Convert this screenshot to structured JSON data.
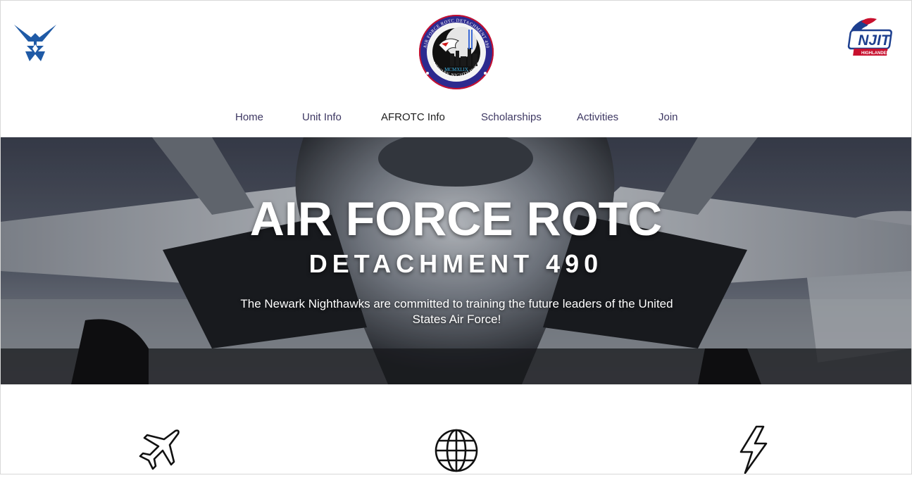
{
  "header": {
    "left_logo": "air-force-wings-logo",
    "center_logo": {
      "ring_top_text": "AIR FORCE ROTC DETACHMENT 490",
      "ring_bottom_text": "NEWARK NIGHTHAWKS",
      "center_text": "MCMXLIX"
    },
    "right_logo": {
      "name": "NJIT",
      "sub": "HIGHLANDERS"
    }
  },
  "nav": {
    "items": [
      {
        "label": "Home"
      },
      {
        "label": "Unit Info"
      },
      {
        "label": "AFROTC Info"
      },
      {
        "label": "Scholarships"
      },
      {
        "label": "Activities"
      },
      {
        "label": "Join"
      }
    ],
    "active": "AFROTC Info"
  },
  "hero": {
    "title": "AIR FORCE ROTC",
    "subtitle": "DETACHMENT 490",
    "description": "The Newark Nighthawks are committed to training the future leaders of the United States Air Force!"
  },
  "features": {
    "icons": [
      "airplane-icon",
      "globe-icon",
      "lightning-icon"
    ]
  },
  "colors": {
    "nav_text": "#3d3762",
    "brand_navy": "#1d3f8f",
    "hero_text": "#ffffff"
  }
}
